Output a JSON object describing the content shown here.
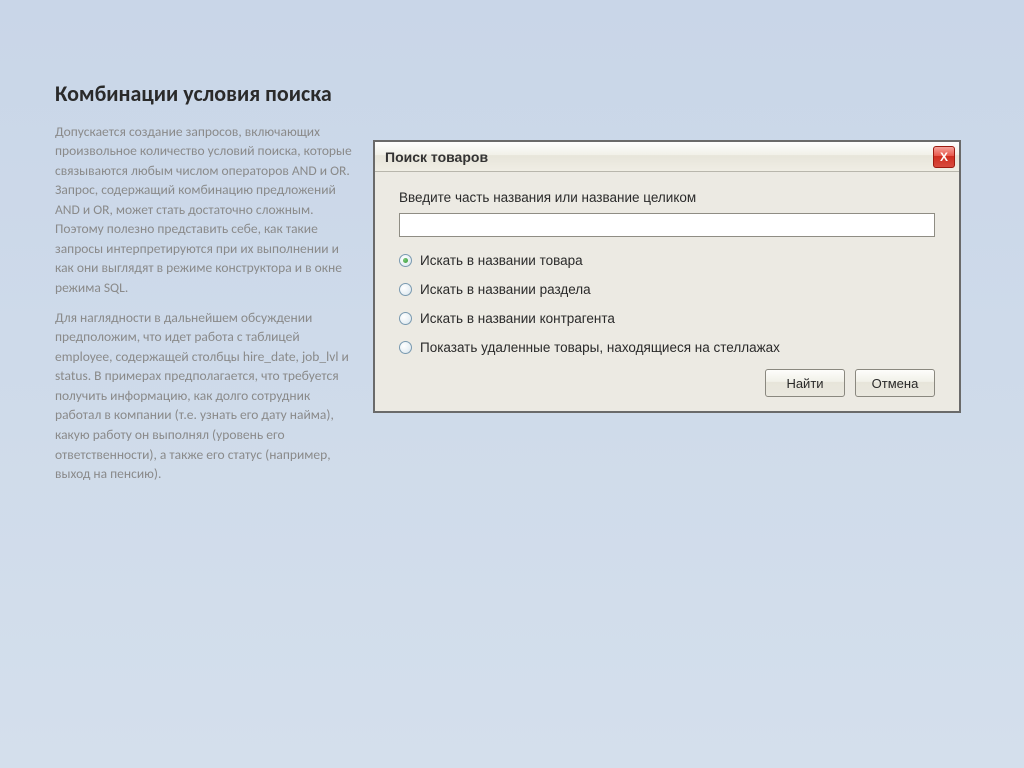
{
  "slide": {
    "title": "Комбинации условия поиска",
    "para1": "Допускается создание запросов, включающих произвольное количество условий поиска, которые связываются любым числом операторов AND и OR. Запрос, содержащий комбинацию предложений AND и OR, может стать достаточно сложным. Поэтому полезно представить себе, как такие запросы интерпретируются при их выполнении и как они выглядят в режиме конструктора и в окне режима SQL.",
    "para2": "Для наглядности в дальнейшем обсуждении предположим, что идет работа с таблицей employee, содержащей столбцы hire_date, job_lvl и status. В примерах предполагается, что требуется получить информацию, как долго сотрудник работал в компании (т.е. узнать его дату найма), какую работу он выполнял (уровень его ответственности), а также его статус (например, выход на пенсию)."
  },
  "dialog": {
    "title": "Поиск товаров",
    "close_glyph": "X",
    "prompt": "Введите часть названия или название целиком",
    "input_value": "",
    "options": [
      {
        "label": "Искать в названии товара",
        "checked": true
      },
      {
        "label": "Искать в названии раздела",
        "checked": false
      },
      {
        "label": "Искать в названии контрагента",
        "checked": false
      },
      {
        "label": "Показать удаленные товары, находящиеся на стеллажах",
        "checked": false
      }
    ],
    "buttons": {
      "find": "Найти",
      "cancel": "Отмена"
    }
  }
}
